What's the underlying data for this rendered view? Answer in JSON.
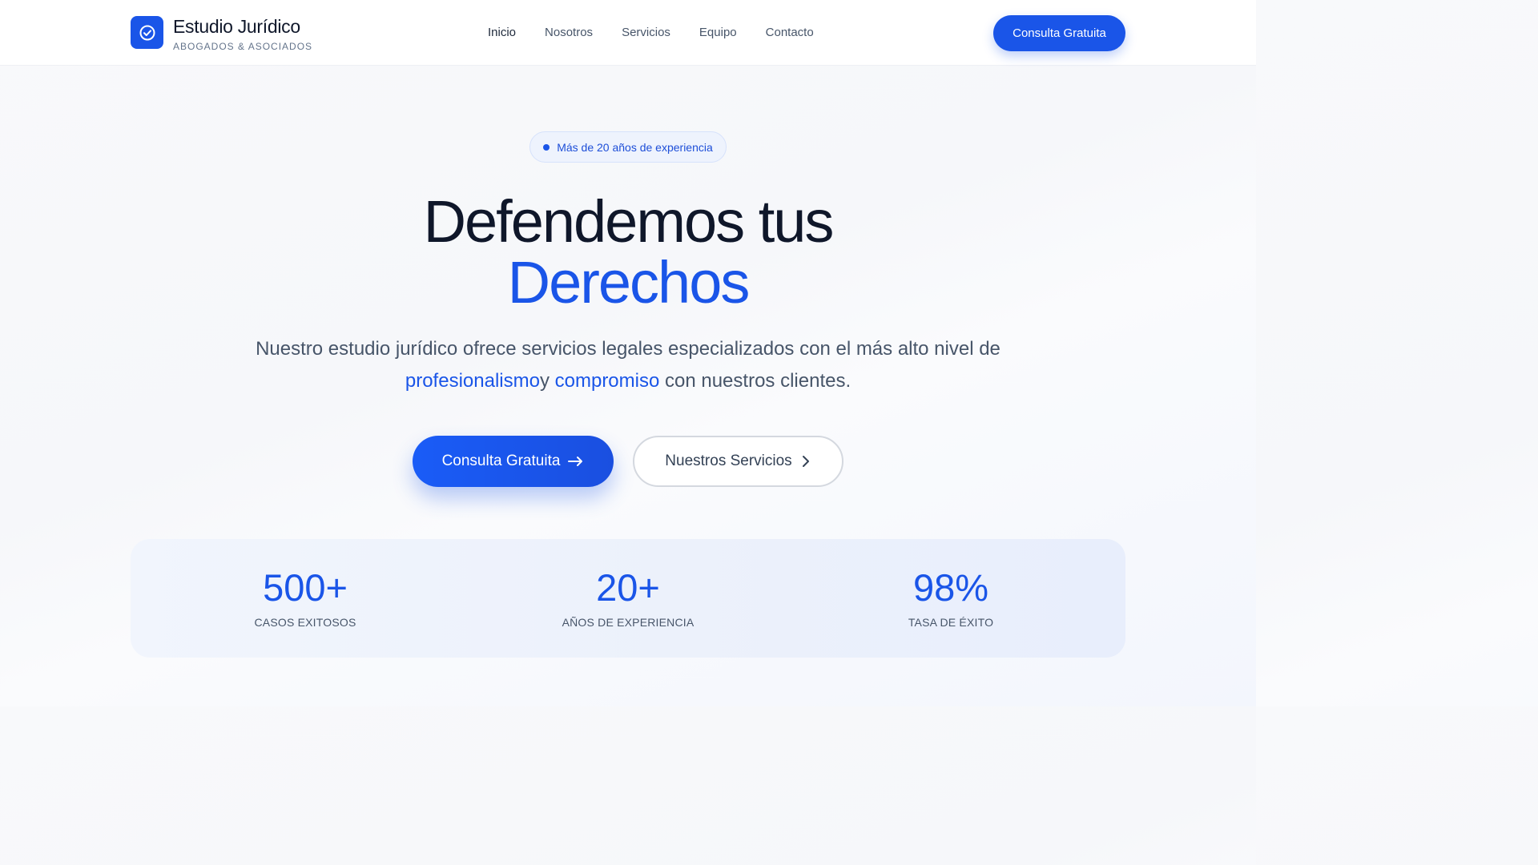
{
  "brand": {
    "name": "Estudio Jurídico",
    "subtitle": "ABOGADOS & ASOCIADOS",
    "logo_icon": "check-circle-icon"
  },
  "nav": {
    "links": [
      "Inicio",
      "Nosotros",
      "Servicios",
      "Equipo",
      "Contacto"
    ],
    "cta_label": "Consulta Gratuita"
  },
  "hero": {
    "badge": "Más de 20 años de experiencia",
    "title_line1": "Defendemos tus",
    "title_line2": "Derechos",
    "subtitle_part1": "Nuestro estudio jurídico ofrece servicios legales especializados con el más alto nivel de",
    "subtitle_accent1": "profesionalismo",
    "subtitle_part2": "y",
    "subtitle_accent2": "compromiso",
    "subtitle_part3": "con nuestros clientes.",
    "primary_button": "Consulta Gratuita",
    "primary_icon": "arrow-right-icon",
    "secondary_button": "Nuestros Servicios",
    "secondary_icon": "chevron-right-icon"
  },
  "stats": [
    {
      "value": "500+",
      "label": "CASOS EXITOSOS"
    },
    {
      "value": "20+",
      "label": "AÑOS DE EXPERIENCIA"
    },
    {
      "value": "98%",
      "label": "TASA DE ÉXITO"
    }
  ],
  "colors": {
    "accent": "#1a55e8",
    "text_dark": "#0f172a",
    "text_muted": "#475569"
  }
}
